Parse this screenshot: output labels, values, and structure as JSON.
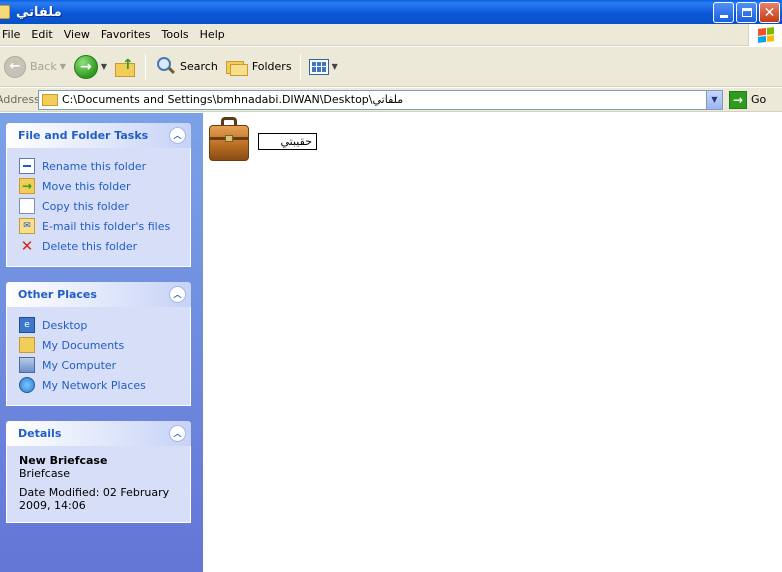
{
  "window": {
    "title": "ملفاتي"
  },
  "menu": [
    "File",
    "Edit",
    "View",
    "Favorites",
    "Tools",
    "Help"
  ],
  "toolbar": {
    "back_label": "Back",
    "search_label": "Search",
    "folders_label": "Folders"
  },
  "address": {
    "label": "Address",
    "value": "C:\\Documents and Settings\\bmhnadabi.DIWAN\\Desktop\\ملفاتي",
    "go_label": "Go"
  },
  "tasks_panel": {
    "title": "File and Folder Tasks",
    "items": [
      {
        "label": "Rename this folder",
        "icon": "rename-icon"
      },
      {
        "label": "Move this folder",
        "icon": "move-folder-icon"
      },
      {
        "label": "Copy this folder",
        "icon": "copy-folder-icon"
      },
      {
        "label": "E-mail this folder's files",
        "icon": "email-icon"
      },
      {
        "label": "Delete this folder",
        "icon": "delete-icon"
      }
    ]
  },
  "places_panel": {
    "title": "Other Places",
    "items": [
      {
        "label": "Desktop",
        "icon": "desktop-icon"
      },
      {
        "label": "My Documents",
        "icon": "my-documents-icon"
      },
      {
        "label": "My Computer",
        "icon": "my-computer-icon"
      },
      {
        "label": "My Network Places",
        "icon": "network-places-icon"
      }
    ]
  },
  "details_panel": {
    "title": "Details",
    "name": "New Briefcase",
    "type": "Briefcase",
    "modified_line1": "Date Modified: 02 February",
    "modified_line2": "2009, 14:06"
  },
  "content": {
    "items": [
      {
        "name_editing": "حقيبتي",
        "icon": "briefcase-icon"
      }
    ]
  },
  "colors": {
    "titlebar": "#0a58d8",
    "taskpane_top": "#7ba2e7",
    "taskpane_bottom": "#6375d6",
    "link": "#215dc6",
    "chrome": "#ece9d8"
  }
}
